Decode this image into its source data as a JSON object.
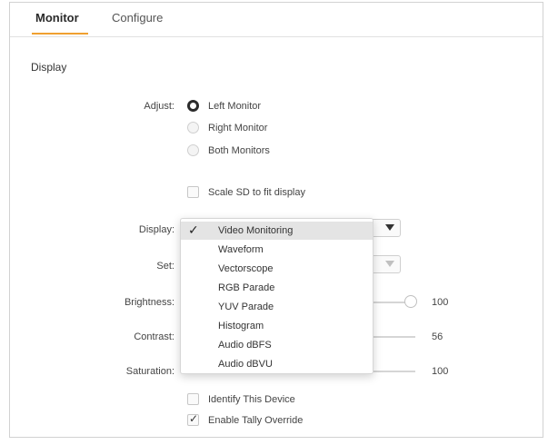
{
  "tabs": [
    {
      "label": "Monitor",
      "active": true
    },
    {
      "label": "Configure",
      "active": false
    }
  ],
  "section_title": "Display",
  "adjust": {
    "label": "Adjust:",
    "options": [
      "Left Monitor",
      "Right Monitor",
      "Both Monitors"
    ],
    "selected": "Left Monitor"
  },
  "scale_sd": {
    "label": "Scale SD to fit display",
    "checked": false
  },
  "display": {
    "label": "Display:",
    "value": "Video Monitoring",
    "options": [
      "Video Monitoring",
      "Waveform",
      "Vectorscope",
      "RGB Parade",
      "YUV Parade",
      "Histogram",
      "Audio dBFS",
      "Audio dBVU"
    ]
  },
  "set": {
    "label": "Set:"
  },
  "brightness": {
    "label": "Brightness:",
    "value": "100",
    "level": 1.0
  },
  "contrast": {
    "label": "Contrast:",
    "value": "56",
    "level": 0.56
  },
  "saturation": {
    "label": "Saturation:",
    "value": "100",
    "level": 1.0
  },
  "identify_device": {
    "label": "Identify This Device",
    "checked": false
  },
  "tally_override": {
    "label": "Enable Tally Override",
    "checked": true
  },
  "colors": {
    "accent": "#f0a030"
  }
}
